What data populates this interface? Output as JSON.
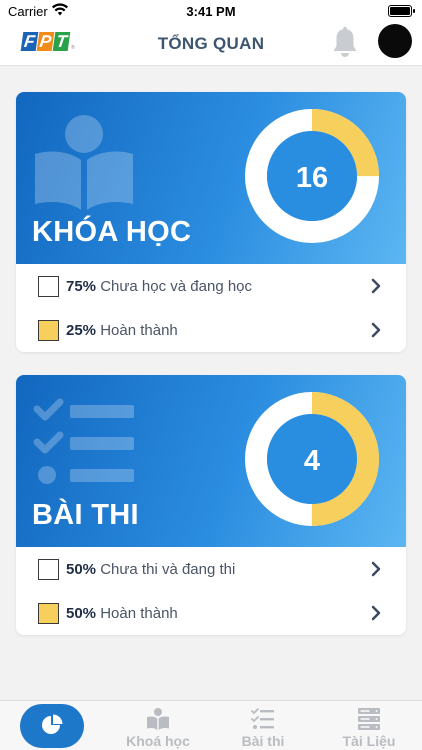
{
  "status_bar": {
    "carrier": "Carrier",
    "time": "3:41 PM"
  },
  "header": {
    "logo": [
      "F",
      "P",
      "T"
    ],
    "logo_mark": "®",
    "title": "TỔNG QUAN"
  },
  "courses": {
    "label": "KHÓA HỌC",
    "total": "16",
    "completed_fraction": 0.25,
    "rows": [
      {
        "pct": "75%",
        "text": "Chưa học và đang học"
      },
      {
        "pct": "25%",
        "text": "Hoàn thành"
      }
    ]
  },
  "exams": {
    "label": "BÀI THI",
    "total": "4",
    "completed_fraction": 0.5,
    "rows": [
      {
        "pct": "50%",
        "text": "Chưa thi và đang thi"
      },
      {
        "pct": "50%",
        "text": "Hoàn thành"
      }
    ]
  },
  "tabbar": {
    "items": [
      {
        "label": "",
        "icon": "pie-chart-icon",
        "active": true
      },
      {
        "label": "Khoá học",
        "icon": "book-reader-icon"
      },
      {
        "label": "Bài thi",
        "icon": "checklist-icon"
      },
      {
        "label": "Tài Liệu",
        "icon": "server-icon"
      }
    ]
  },
  "colors": {
    "primary": "#1e78c9",
    "banner_start": "#1267bf",
    "banner_end": "#5cb6f2",
    "accent_yellow": "#f7cf5c",
    "donut_center": "#2a8ee0",
    "tab_inactive": "#b9bcc1"
  }
}
